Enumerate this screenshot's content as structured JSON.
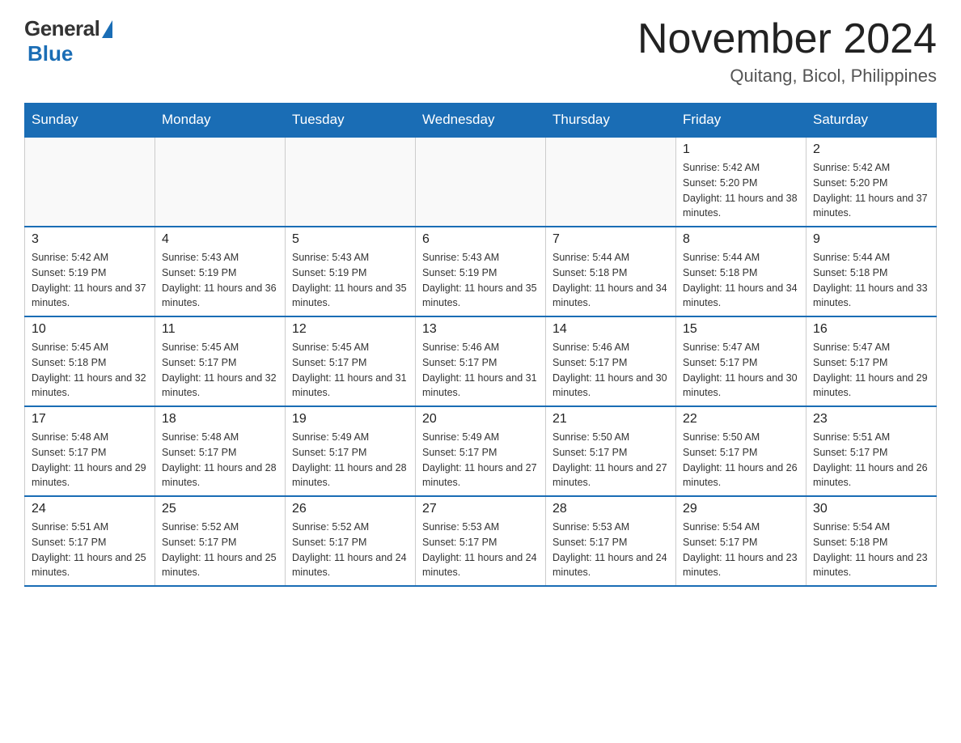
{
  "header": {
    "month_title": "November 2024",
    "location": "Quitang, Bicol, Philippines",
    "logo_general": "General",
    "logo_blue": "Blue"
  },
  "calendar": {
    "days_of_week": [
      "Sunday",
      "Monday",
      "Tuesday",
      "Wednesday",
      "Thursday",
      "Friday",
      "Saturday"
    ],
    "weeks": [
      [
        {
          "day": "",
          "info": ""
        },
        {
          "day": "",
          "info": ""
        },
        {
          "day": "",
          "info": ""
        },
        {
          "day": "",
          "info": ""
        },
        {
          "day": "",
          "info": ""
        },
        {
          "day": "1",
          "info": "Sunrise: 5:42 AM\nSunset: 5:20 PM\nDaylight: 11 hours and 38 minutes."
        },
        {
          "day": "2",
          "info": "Sunrise: 5:42 AM\nSunset: 5:20 PM\nDaylight: 11 hours and 37 minutes."
        }
      ],
      [
        {
          "day": "3",
          "info": "Sunrise: 5:42 AM\nSunset: 5:19 PM\nDaylight: 11 hours and 37 minutes."
        },
        {
          "day": "4",
          "info": "Sunrise: 5:43 AM\nSunset: 5:19 PM\nDaylight: 11 hours and 36 minutes."
        },
        {
          "day": "5",
          "info": "Sunrise: 5:43 AM\nSunset: 5:19 PM\nDaylight: 11 hours and 35 minutes."
        },
        {
          "day": "6",
          "info": "Sunrise: 5:43 AM\nSunset: 5:19 PM\nDaylight: 11 hours and 35 minutes."
        },
        {
          "day": "7",
          "info": "Sunrise: 5:44 AM\nSunset: 5:18 PM\nDaylight: 11 hours and 34 minutes."
        },
        {
          "day": "8",
          "info": "Sunrise: 5:44 AM\nSunset: 5:18 PM\nDaylight: 11 hours and 34 minutes."
        },
        {
          "day": "9",
          "info": "Sunrise: 5:44 AM\nSunset: 5:18 PM\nDaylight: 11 hours and 33 minutes."
        }
      ],
      [
        {
          "day": "10",
          "info": "Sunrise: 5:45 AM\nSunset: 5:18 PM\nDaylight: 11 hours and 32 minutes."
        },
        {
          "day": "11",
          "info": "Sunrise: 5:45 AM\nSunset: 5:17 PM\nDaylight: 11 hours and 32 minutes."
        },
        {
          "day": "12",
          "info": "Sunrise: 5:45 AM\nSunset: 5:17 PM\nDaylight: 11 hours and 31 minutes."
        },
        {
          "day": "13",
          "info": "Sunrise: 5:46 AM\nSunset: 5:17 PM\nDaylight: 11 hours and 31 minutes."
        },
        {
          "day": "14",
          "info": "Sunrise: 5:46 AM\nSunset: 5:17 PM\nDaylight: 11 hours and 30 minutes."
        },
        {
          "day": "15",
          "info": "Sunrise: 5:47 AM\nSunset: 5:17 PM\nDaylight: 11 hours and 30 minutes."
        },
        {
          "day": "16",
          "info": "Sunrise: 5:47 AM\nSunset: 5:17 PM\nDaylight: 11 hours and 29 minutes."
        }
      ],
      [
        {
          "day": "17",
          "info": "Sunrise: 5:48 AM\nSunset: 5:17 PM\nDaylight: 11 hours and 29 minutes."
        },
        {
          "day": "18",
          "info": "Sunrise: 5:48 AM\nSunset: 5:17 PM\nDaylight: 11 hours and 28 minutes."
        },
        {
          "day": "19",
          "info": "Sunrise: 5:49 AM\nSunset: 5:17 PM\nDaylight: 11 hours and 28 minutes."
        },
        {
          "day": "20",
          "info": "Sunrise: 5:49 AM\nSunset: 5:17 PM\nDaylight: 11 hours and 27 minutes."
        },
        {
          "day": "21",
          "info": "Sunrise: 5:50 AM\nSunset: 5:17 PM\nDaylight: 11 hours and 27 minutes."
        },
        {
          "day": "22",
          "info": "Sunrise: 5:50 AM\nSunset: 5:17 PM\nDaylight: 11 hours and 26 minutes."
        },
        {
          "day": "23",
          "info": "Sunrise: 5:51 AM\nSunset: 5:17 PM\nDaylight: 11 hours and 26 minutes."
        }
      ],
      [
        {
          "day": "24",
          "info": "Sunrise: 5:51 AM\nSunset: 5:17 PM\nDaylight: 11 hours and 25 minutes."
        },
        {
          "day": "25",
          "info": "Sunrise: 5:52 AM\nSunset: 5:17 PM\nDaylight: 11 hours and 25 minutes."
        },
        {
          "day": "26",
          "info": "Sunrise: 5:52 AM\nSunset: 5:17 PM\nDaylight: 11 hours and 24 minutes."
        },
        {
          "day": "27",
          "info": "Sunrise: 5:53 AM\nSunset: 5:17 PM\nDaylight: 11 hours and 24 minutes."
        },
        {
          "day": "28",
          "info": "Sunrise: 5:53 AM\nSunset: 5:17 PM\nDaylight: 11 hours and 24 minutes."
        },
        {
          "day": "29",
          "info": "Sunrise: 5:54 AM\nSunset: 5:17 PM\nDaylight: 11 hours and 23 minutes."
        },
        {
          "day": "30",
          "info": "Sunrise: 5:54 AM\nSunset: 5:18 PM\nDaylight: 11 hours and 23 minutes."
        }
      ]
    ]
  }
}
